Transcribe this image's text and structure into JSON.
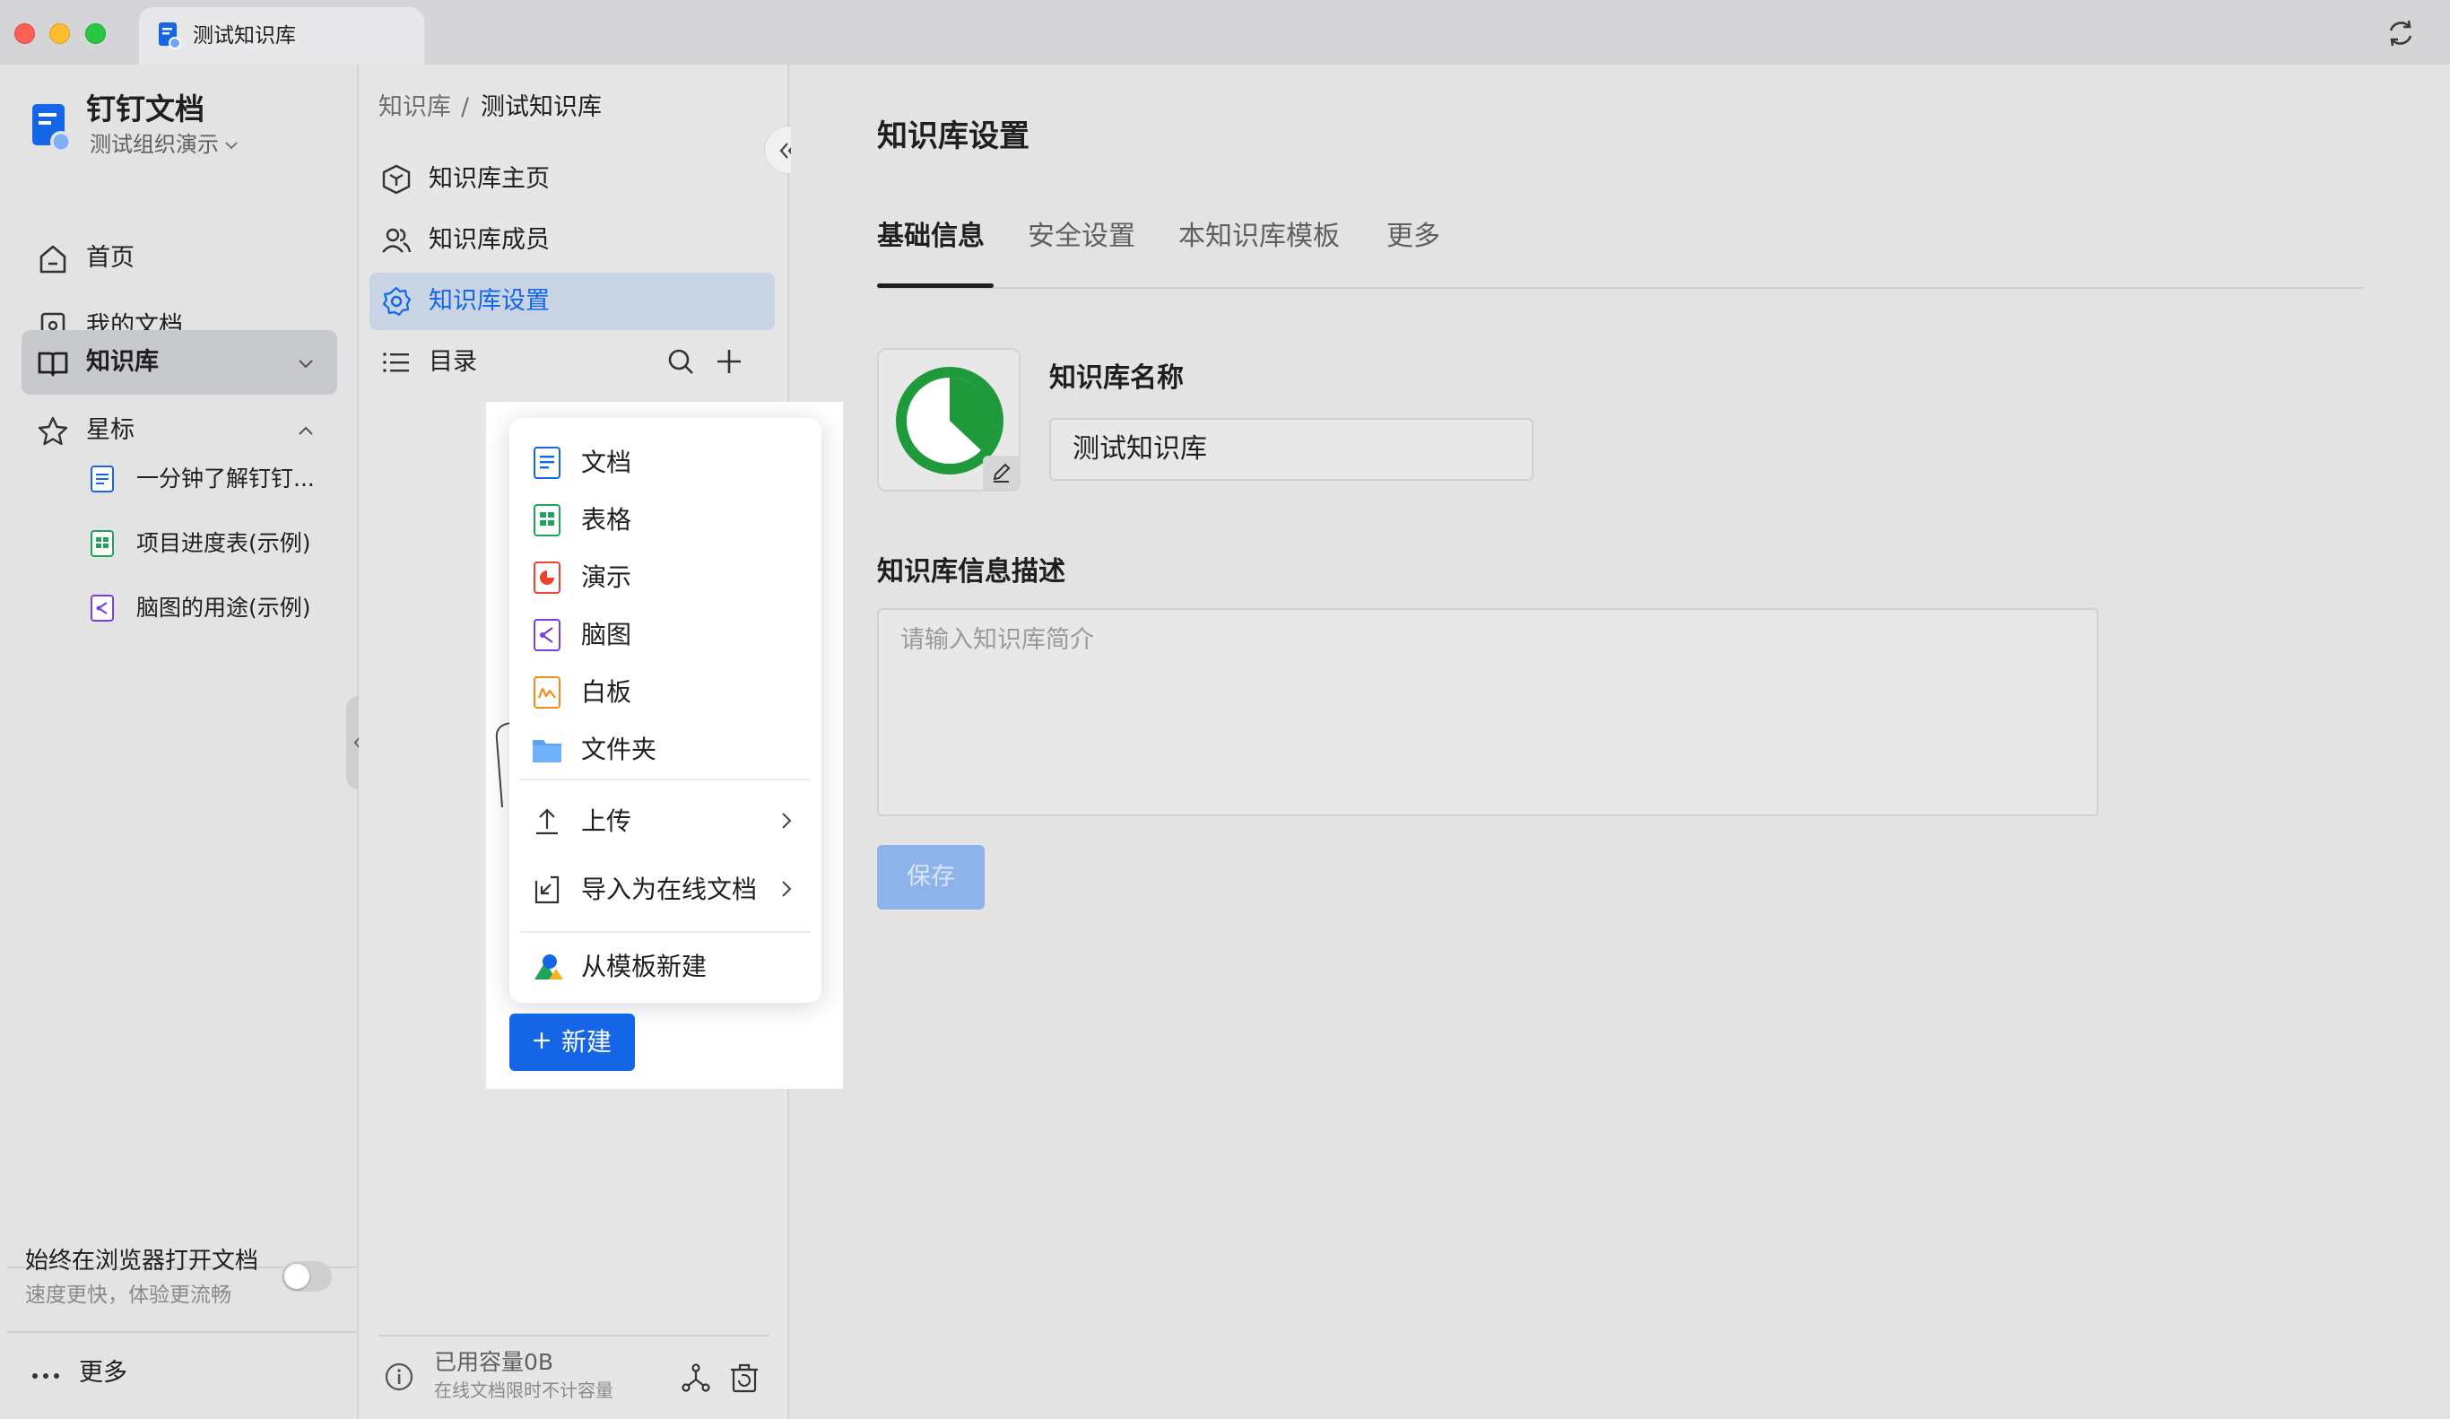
{
  "window": {
    "tab_title": "测试知识库"
  },
  "sidebar": {
    "app_name": "钉钉文档",
    "org_name": "测试组织演示",
    "nav": [
      {
        "label": "首页",
        "icon": "home-icon"
      },
      {
        "label": "我的文档",
        "icon": "my-docs-icon"
      },
      {
        "label": "知识库",
        "icon": "book-icon",
        "selected": true
      },
      {
        "label": "星标",
        "icon": "star-icon"
      }
    ],
    "starred": [
      {
        "label": "一分钟了解钉钉...",
        "icon": "doc-file-icon"
      },
      {
        "label": "项目进度表(示例)",
        "icon": "sheet-file-icon"
      },
      {
        "label": "脑图的用途(示例)",
        "icon": "mindmap-file-icon"
      }
    ],
    "browser_toggle": {
      "title": "始终在浏览器打开文档",
      "subtitle": "速度更快，体验更流畅",
      "enabled": false
    },
    "more_label": "更多"
  },
  "midpanel": {
    "breadcrumb_root": "知识库",
    "breadcrumb_sep": "/",
    "breadcrumb_current": "测试知识库",
    "items": [
      {
        "label": "知识库主页"
      },
      {
        "label": "知识库成员"
      },
      {
        "label": "知识库设置",
        "selected": true
      },
      {
        "label": "目录"
      }
    ],
    "capacity_title": "已用容量0B",
    "capacity_sub": "在线文档限时不计容量"
  },
  "popup_menu": {
    "items": [
      {
        "label": "文档",
        "icon": "doc-icon"
      },
      {
        "label": "表格",
        "icon": "sheet-icon"
      },
      {
        "label": "演示",
        "icon": "slides-icon"
      },
      {
        "label": "脑图",
        "icon": "mindmap-icon"
      },
      {
        "label": "白板",
        "icon": "whiteboard-icon"
      },
      {
        "label": "文件夹",
        "icon": "folder-icon"
      },
      {
        "label": "上传",
        "icon": "upload-icon",
        "submenu": true
      },
      {
        "label": "导入为在线文档",
        "icon": "import-icon",
        "submenu": true
      },
      {
        "label": "从模板新建",
        "icon": "template-icon"
      }
    ],
    "new_button_label": "新建"
  },
  "main": {
    "page_title": "知识库设置",
    "tabs": [
      {
        "label": "基础信息",
        "active": true
      },
      {
        "label": "安全设置"
      },
      {
        "label": "本知识库模板"
      },
      {
        "label": "更多"
      }
    ],
    "kb_name_label": "知识库名称",
    "kb_name_value": "测试知识库",
    "desc_label": "知识库信息描述",
    "desc_placeholder": "请输入知识库简介",
    "save_label": "保存"
  },
  "colors": {
    "accent": "#1466e6",
    "selected_bg": "#c8d4e4",
    "save_disabled": "#8db3ea",
    "kb_icon_green": "#1f9a3a"
  }
}
